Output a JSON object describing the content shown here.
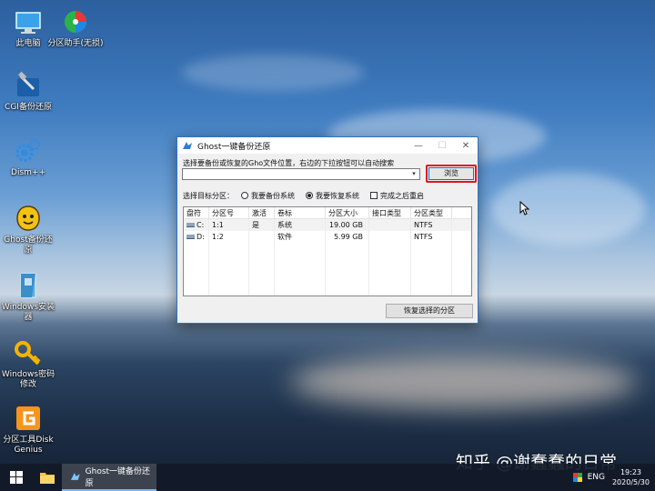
{
  "desktop": {
    "icons": [
      {
        "name": "this-pc",
        "label": "此电脑",
        "icon": "monitor-icon"
      },
      {
        "name": "partition-assistant",
        "label": "分区助手(无损)",
        "icon": "disc-icon"
      },
      {
        "name": "cgi-backup",
        "label": "CGI备份还原",
        "icon": "hammer-icon"
      },
      {
        "name": "dism",
        "label": "Dism++",
        "icon": "gears-icon"
      },
      {
        "name": "ghost-backup",
        "label": "Ghost备份还原",
        "icon": "ghost-icon"
      },
      {
        "name": "windows-installer",
        "label": "Windows安装器",
        "icon": "installer-icon"
      },
      {
        "name": "windows-password",
        "label": "Windows密码修改",
        "icon": "key-icon"
      },
      {
        "name": "diskgenius",
        "label": "分区工具DiskGenius",
        "icon": "diskgenius-icon"
      }
    ]
  },
  "window": {
    "title": "Ghost一键备份还原",
    "minimize": "—",
    "maximize": "☐",
    "close": "✕",
    "hint": "选择要备份或恢复的Gho文件位置，右边的下拉按钮可以自动搜索",
    "path_value": "",
    "browse_label": "浏览",
    "target_label": "选择目标分区：",
    "radio_backup": "我要备份系统",
    "radio_restore": "我要恢复系统",
    "checkbox_restart": "完成之后重启",
    "restore_button": "恢复选择的分区",
    "columns": [
      "盘符",
      "分区号",
      "激活",
      "卷标",
      "分区大小",
      "接口类型",
      "分区类型"
    ],
    "rows": [
      [
        "C:",
        "1:1",
        "是",
        "系统",
        "19.00 GB",
        "",
        "NTFS"
      ],
      [
        "D:",
        "1:2",
        "",
        "软件",
        "5.99 GB",
        "",
        "NTFS"
      ]
    ]
  },
  "taskbar": {
    "task_label": "Ghost一键备份还原",
    "language": "ENG",
    "time": "19:23",
    "date": "2020/5/30"
  },
  "watermark": "知乎 @谢蠢蠢的日常",
  "colors": {
    "highlight": "#e0161b",
    "title_accent": "#2b73c9"
  }
}
